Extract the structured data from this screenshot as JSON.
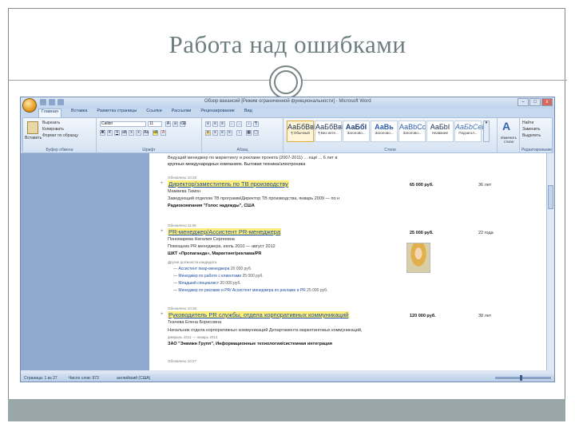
{
  "slide": {
    "title": "Работа над ошибками"
  },
  "window": {
    "title": "Обзор вакансий [Режим ограниченной функциональности] - Microsoft Word",
    "controls": {
      "minimize": "–",
      "maximize": "□",
      "close": "x"
    }
  },
  "ribbon": {
    "tabs": [
      "Главная",
      "Вставка",
      "Разметка страницы",
      "Ссылки",
      "Рассылки",
      "Рецензирование",
      "Вид"
    ],
    "clipboard": {
      "paste": "Вставить",
      "cut": "Вырезать",
      "copy": "Копировать",
      "format_painter": "Формат по образцу",
      "label": "Буфер обмена"
    },
    "font": {
      "name": "Calibri",
      "size": "11",
      "label": "Шрифт"
    },
    "paragraph": {
      "label": "Абзац"
    },
    "styles": {
      "items": [
        {
          "sample": "АаБбВвГ",
          "name": "¶ Обычный"
        },
        {
          "sample": "АаБбВвГ",
          "name": "¶ Без инте..."
        },
        {
          "sample": "АаБбІ",
          "name": "Заголово..."
        },
        {
          "sample": "АаВь",
          "name": "Заголово..."
        },
        {
          "sample": "АаВbСс",
          "name": "Заголово..."
        },
        {
          "sample": "АаБbІ",
          "name": "Название"
        },
        {
          "sample": "АаБbСеЕ",
          "name": "Подзагол..."
        }
      ],
      "change_styles": "Изменить стили",
      "label": "Стили"
    },
    "editing": {
      "find": "Найти",
      "replace": "Заменить",
      "select": "Выделить",
      "label": "Редактирование"
    }
  },
  "document": {
    "top_line": "Ведущий менеджер по маркетингу и рекламе проекта (2007-2011) ... ещё ... 6 лет в",
    "top_line2": "крупных международных компаниях. Бытовая техника/электроника",
    "listings": [
      {
        "meta": "Обновлено 10:26",
        "title": "Директор/заместитель по ТВ производству",
        "name": "Мамаева Тимон",
        "line1": "Заведующий отделом ТВ программ/Директор ТВ производства, январь 2009 — по н",
        "line2": "Радиокомпания \"Голос надежды\", США",
        "salary": "65 000 руб.",
        "age": "36 лет"
      },
      {
        "meta": "Обновлено 11:08",
        "title": "PR-менеджер/Ассистент PR-менеджера",
        "name": "Пономарева Наталия Сергеевна",
        "line1": "Помощник PR менеджера, июль 2010 — август 2012",
        "line2": "ШКТ «Пропаганда», Маркетинг/реклама/PR",
        "salary": "25 000 руб.",
        "age": "22 года",
        "sub_header": "Другие должности кандидата",
        "sub": [
          {
            "text": "Ассистент пиар-менеджера",
            "sal": "20 000 руб."
          },
          {
            "text": "Менеджер по работе с клиентами",
            "sal": "25 000 руб."
          },
          {
            "text": "Младший специалист",
            "sal": "20 000 руб."
          },
          {
            "text": "Менеджер по рекламе и PR/ Ассистент менеджера по рекламе и PR",
            "sal": "25 000 руб."
          }
        ]
      },
      {
        "meta": "Обновлено 10:26",
        "title": "Руководитель PR службы, отдела корпоративных коммуникаций",
        "name": "Ткачева Елена Борисовна",
        "line1": "Начальник отдела корпоративных коммуникаций Департамента маркетинговых коммуникаций,",
        "line1b": "февраль 2011 — январь 2013",
        "line2": "ЗАО \"Энвижн Групп\", Информационные технологии/системная интеграция",
        "salary": "120 000 руб.",
        "age": "38 лет"
      }
    ],
    "bottom_meta": "Обновлено 10:27"
  },
  "status": {
    "page": "Страница: 1 из 27",
    "words": "Число слов: 973",
    "lang": "английский (США)"
  }
}
